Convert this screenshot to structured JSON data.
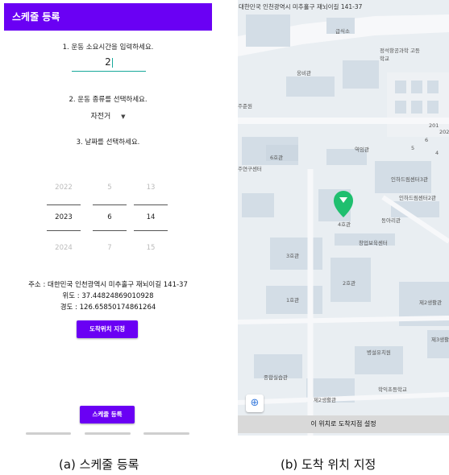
{
  "left": {
    "title": "스케줄 등록",
    "q1": "1. 운동 소요시간을 입력하세요.",
    "hours_value": "2",
    "q2": "2. 운동 종류를 선택하세요.",
    "exercise_type": "자전거",
    "q3": "3. 날짜를 선택하세요.",
    "date_picker": {
      "years": [
        "2022",
        "2023",
        "2024"
      ],
      "months": [
        "5",
        "6",
        "7"
      ],
      "days": [
        "13",
        "14",
        "15"
      ]
    },
    "address": "주소 : 대한민국 인천광역시 미추홀구 재뇌이길 141-37",
    "latitude": "위도 : 37.44824869010928",
    "longitude": "경도 : 126.65850174861264",
    "set_location_button": "도착위치 지정",
    "register_button": "스케줄 등록"
  },
  "right": {
    "top_address": "대한민국 인천광역시 미추홀구 재뇌이길 141-37",
    "map_labels": {
      "l1": "급식소",
      "l2": "정석항공과학 고등학교",
      "l3": "웅비관",
      "l4": "6호관",
      "l5": "역임관",
      "l6": "인하드림센터3관",
      "l7": "인하드림센터2관",
      "l8": "동아리관",
      "l9": "4호관",
      "l10": "창업보육센터",
      "l11": "3호관",
      "l12": "2호관",
      "l13": "1호관",
      "l14": "제2생활관",
      "l15": "병설유치원",
      "l16": "학익초등학교",
      "l17": "종합실습관",
      "l18": "제2생활관",
      "l19": "제3생활",
      "l20": "주준원",
      "l21": "주연구센터",
      "l22": "201",
      "l23": "202",
      "l24": "5",
      "l25": "4",
      "l26": "6"
    },
    "confirm_button": "이 위치로 도착지점 설정"
  },
  "captions": {
    "left": "(a) 스케줄 등록",
    "right": "(b) 도착 위치 지정"
  },
  "colors": {
    "primary": "#6a00f4",
    "accent": "#17a99b",
    "marker": "#1fbf6f"
  }
}
